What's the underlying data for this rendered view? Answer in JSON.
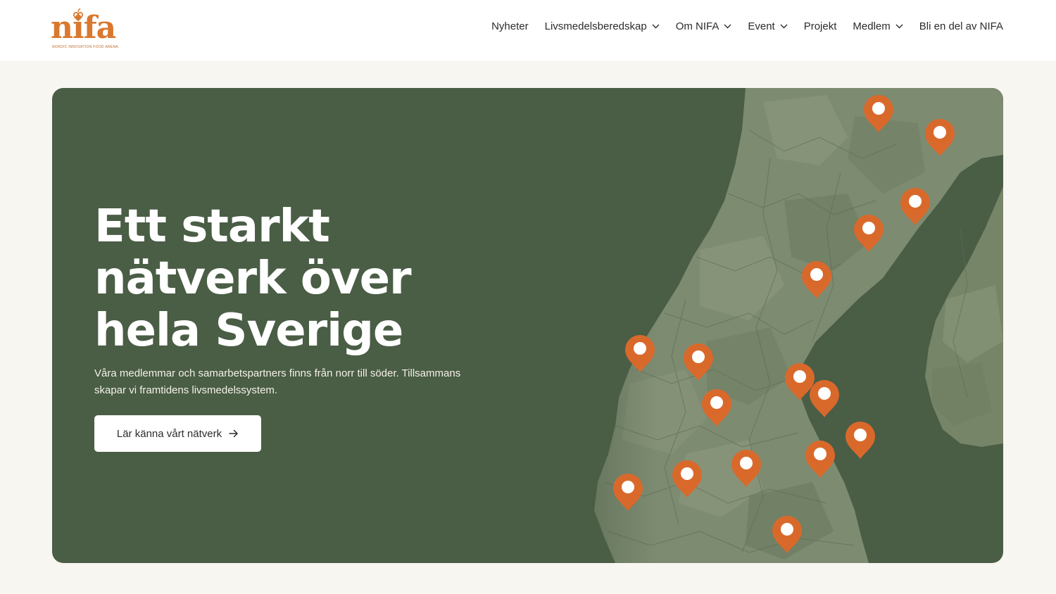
{
  "logo": {
    "wordmark": "nifa",
    "tagline": "NORDIC INNOVATION FOOD ARENA",
    "color": "#d9782f"
  },
  "nav": {
    "items": [
      {
        "label": "Nyheter",
        "dropdown": false
      },
      {
        "label": "Livsmedelsberedskap",
        "dropdown": true
      },
      {
        "label": "Om NIFA",
        "dropdown": true
      },
      {
        "label": "Event",
        "dropdown": true
      },
      {
        "label": "Projekt",
        "dropdown": false
      },
      {
        "label": "Medlem",
        "dropdown": true
      },
      {
        "label": "Bli en del av NIFA",
        "dropdown": false
      }
    ]
  },
  "hero": {
    "title": "Ett starkt nätverk över hela Sverige",
    "text": "Våra medlemmar och samarbetspartners finns från norr till söder. Tillsammans skapar vi framtidens livsmedelssystem.",
    "cta_label": "Lär känna vårt nätverk",
    "cta_icon": "arrow-right-icon",
    "background_color": "#4a5d45",
    "map_land_color": "#7d8b71",
    "pin_color": "#d9692b",
    "pin_count": 17
  }
}
